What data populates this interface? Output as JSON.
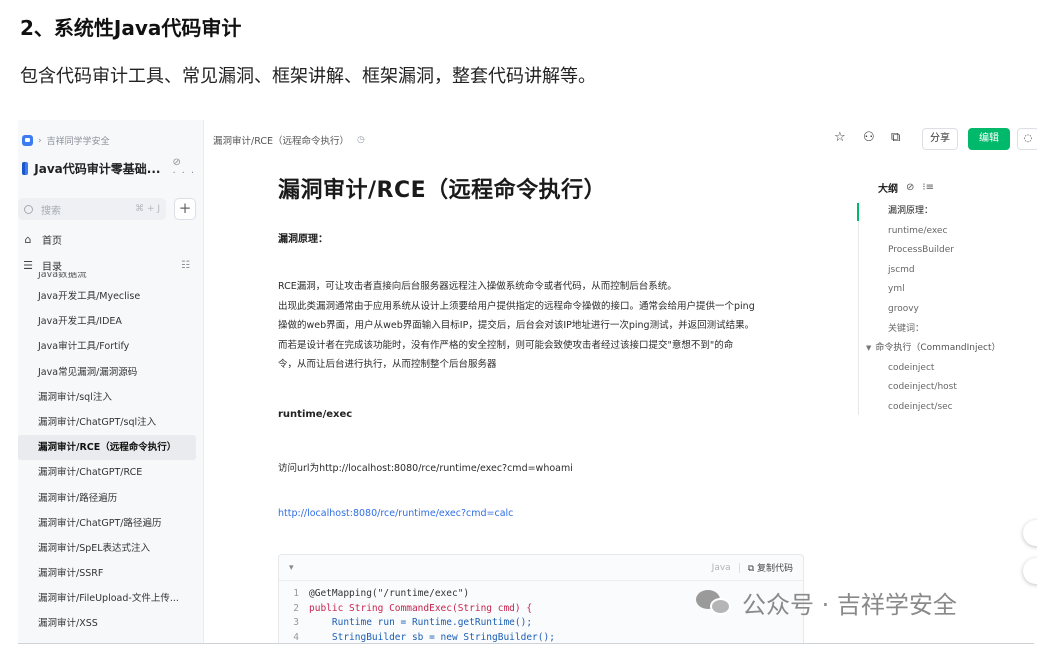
{
  "article": {
    "heading": "2、系统性Java代码审计",
    "description": "包含代码审计工具、常见漏洞、框架讲解、框架漏洞，整套代码讲解等。"
  },
  "sidebar": {
    "breadcrumb": "吉祥同学学安全",
    "kb_title": "Java代码审计零基础...",
    "search_placeholder": "搜索",
    "search_shortcut": "⌘ + J",
    "home_label": "首页",
    "toc_label": "目录",
    "toc_items": [
      "Java数据流",
      "Java开发工具/Myeclise",
      "Java开发工具/IDEA",
      "Java审计工具/Fortify",
      "Java常见漏洞/漏洞源码",
      "漏洞审计/sql注入",
      "漏洞审计/ChatGPT/sql注入",
      "漏洞审计/RCE（远程命令执行）",
      "漏洞审计/ChatGPT/RCE",
      "漏洞审计/路径遍历",
      "漏洞审计/ChatGPT/路径遍历",
      "漏洞审计/SpEL表达式注入",
      "漏洞审计/SSRF",
      "漏洞审计/FileUpload-文件上传...",
      "漏洞审计/XSS"
    ]
  },
  "topbar": {
    "path": "漏洞审计/RCE（远程命令执行）",
    "share_label": "分享",
    "edit_label": "编辑"
  },
  "doc": {
    "title": "漏洞审计/RCE（远程命令执行）",
    "section_principle": "漏洞原理：",
    "paragraph": [
      "RCE漏洞，可让攻击者直接向后台服务器远程注入操做系统命令或者代码，从而控制后台系统。",
      "出现此类漏洞通常由于应用系统从设计上须要给用户提供指定的远程命令操做的接口。通常会给用户提供一个ping",
      "操做的web界面，用户从web界面输入目标IP，提交后，后台会对该IP地址进行一次ping测试，并返回测试结果。",
      " 而若是设计者在完成该功能时，没有作严格的安全控制，则可能会致使攻击者经过该接口提交\"意想不到\"的命",
      "令，从而让后台进行执行，从而控制整个后台服务器"
    ],
    "section_runtime": "runtime/exec",
    "visit_text": "访问url为http://localhost:8080/rce/runtime/exec?cmd=whoami",
    "link_text": "http://localhost:8080/rce/runtime/exec?cmd=calc",
    "code": {
      "lang": "Java",
      "copy_label": "复制代码",
      "line_numbers": [
        "1",
        "2",
        "3",
        "4"
      ],
      "lines": [
        "@GetMapping(\"/runtime/exec\")",
        "public String CommandExec(String cmd) {",
        "    Runtime run = Runtime.getRuntime();",
        "    StringBuilder sb = new StringBuilder();"
      ]
    }
  },
  "outline": {
    "title": "大纲",
    "items": [
      "漏洞原理：",
      "runtime/exec",
      "ProcessBuilder",
      "jscmd",
      "yml",
      "groovy",
      "关键词：",
      "命令执行（CommandInject）",
      "codeinject",
      "codeinject/host",
      "codeinject/sec"
    ]
  },
  "watermark": {
    "text": "公众号 · 吉祥学安全"
  },
  "colors": {
    "accent_green": "#00b96b",
    "link_blue": "#2f6ee3",
    "brand_blue": "#3b7cf0"
  },
  "icons": [
    "star-icon",
    "add-member-icon",
    "present-icon",
    "comment-icon",
    "book-icon",
    "search-icon",
    "home-icon",
    "toc-icon",
    "eye-off-icon",
    "list-icon",
    "copy-icon"
  ]
}
